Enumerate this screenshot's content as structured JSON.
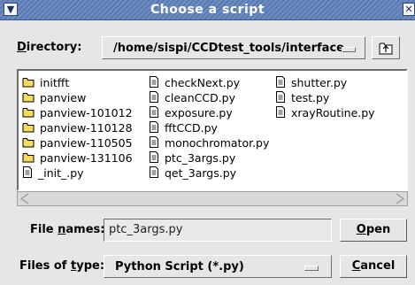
{
  "window": {
    "title": "Choose a script",
    "menu_icon": "chevron-down-icon",
    "close_icon": "close-icon"
  },
  "directory": {
    "label_first": "D",
    "label_rest": "irectory:",
    "path": "/home/sispi/CCDtest_tools/interface",
    "up_icon": "folder-up-icon"
  },
  "files": {
    "columns": [
      [
        {
          "name": "initfft",
          "kind": "folder"
        },
        {
          "name": "panview",
          "kind": "folder"
        },
        {
          "name": "panview-101012",
          "kind": "folder"
        },
        {
          "name": "panview-110128",
          "kind": "folder"
        },
        {
          "name": "panview-110505",
          "kind": "folder"
        },
        {
          "name": "panview-131106",
          "kind": "folder"
        },
        {
          "name": "_init_.py",
          "kind": "file"
        }
      ],
      [
        {
          "name": "checkNext.py",
          "kind": "file"
        },
        {
          "name": "cleanCCD.py",
          "kind": "file"
        },
        {
          "name": "exposure.py",
          "kind": "file"
        },
        {
          "name": "fftCCD.py",
          "kind": "file"
        },
        {
          "name": "monochromator.py",
          "kind": "file"
        },
        {
          "name": "ptc_3args.py",
          "kind": "file"
        },
        {
          "name": "qet_3args.py",
          "kind": "file"
        }
      ],
      [
        {
          "name": "shutter.py",
          "kind": "file"
        },
        {
          "name": "test.py",
          "kind": "file"
        },
        {
          "name": "xrayRoutine.py",
          "kind": "file"
        }
      ]
    ]
  },
  "file_names": {
    "label_pre": "File ",
    "label_ul": "n",
    "label_post": "ames:",
    "value": "ptc_3args.py",
    "open_ul": "O",
    "open_rest": "pen"
  },
  "file_type": {
    "label_pre": "Files of ",
    "label_ul": "t",
    "label_post": "ype:",
    "value": "Python Script (*.py)",
    "cancel_ul": "C",
    "cancel_rest": "ancel"
  }
}
